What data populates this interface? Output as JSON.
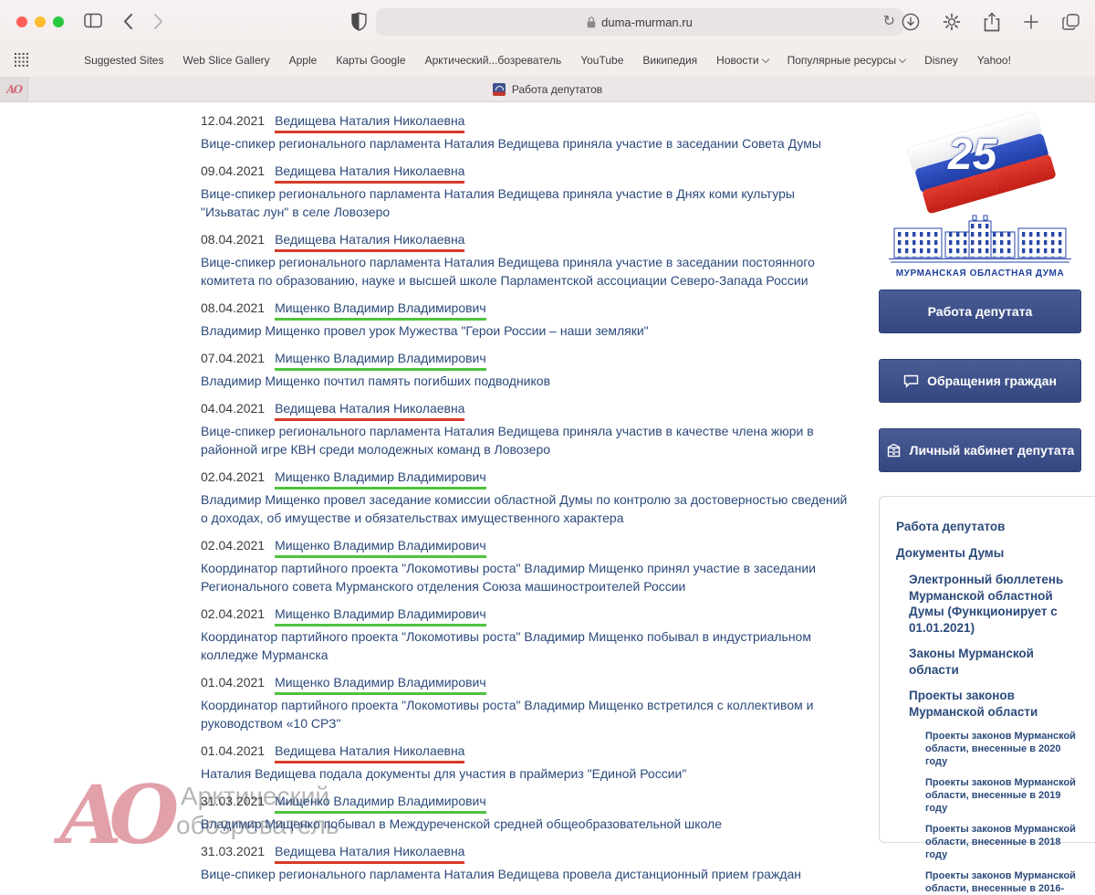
{
  "browser": {
    "traffic_lights": {
      "close": "#ff5f57",
      "minimize": "#febc2e",
      "zoom": "#28c840"
    },
    "address": {
      "url": "duma-murman.ru"
    },
    "bookmarks": [
      {
        "label": "Suggested Sites",
        "chevron": false
      },
      {
        "label": "Web Slice Gallery",
        "chevron": false
      },
      {
        "label": "Apple",
        "chevron": false
      },
      {
        "label": "Карты Google",
        "chevron": false
      },
      {
        "label": "Арктический...бозреватель",
        "chevron": false
      },
      {
        "label": "YouTube",
        "chevron": false
      },
      {
        "label": "Википедия",
        "chevron": false
      },
      {
        "label": "Новости",
        "chevron": true
      },
      {
        "label": "Популярные ресурсы",
        "chevron": true
      },
      {
        "label": "Disney",
        "chevron": false
      },
      {
        "label": "Yahoo!",
        "chevron": false
      }
    ],
    "tab": {
      "pinned_label": "АО",
      "title": "Работа депутатов"
    }
  },
  "news": [
    {
      "date": "12.04.2021",
      "author": "Ведищева Наталия Николаевна",
      "underline_color": "#d63b27",
      "text": "Вице-спикер регионального парламента Наталия Ведищева приняла участие в заседании Совета Думы"
    },
    {
      "date": "09.04.2021",
      "author": "Ведищева Наталия Николаевна",
      "underline_color": "#d63b27",
      "text": "Вице-спикер регионального парламента Наталия Ведищева приняла участие в Днях коми культуры \"Изьватас лун\" в селе Ловозеро"
    },
    {
      "date": "08.04.2021",
      "author": "Ведищева Наталия Николаевна",
      "underline_color": "#d63b27",
      "text": "Вице-спикер регионального парламента Наталия Ведищева приняла участие в заседании постоянного комитета по образованию, науке и высшей школе Парламентской ассоциации Северо-Запада России"
    },
    {
      "date": "08.04.2021",
      "author": "Мищенко Владимир Владимирович",
      "underline_color": "#4fc33f",
      "text": "Владимир Мищенко провел урок Мужества \"Герои России – наши земляки\""
    },
    {
      "date": "07.04.2021",
      "author": "Мищенко Владимир Владимирович",
      "underline_color": "#4fc33f",
      "text": "Владимир Мищенко почтил память погибших подводников"
    },
    {
      "date": "04.04.2021",
      "author": "Ведищева Наталия Николаевна",
      "underline_color": "#d63b27",
      "text": "Вице-спикер регионального парламента Наталия Ведищева приняла участив в качестве члена жюри в районной игре КВН среди молодежных команд в Ловозеро"
    },
    {
      "date": "02.04.2021",
      "author": "Мищенко Владимир Владимирович",
      "underline_color": "#4fc33f",
      "text": "Владимир Мищенко провел заседание комиссии областной Думы по контролю за достоверностью сведений о доходах, об имуществе и обязательствах имущественного характера"
    },
    {
      "date": "02.04.2021",
      "author": "Мищенко Владимир Владимирович",
      "underline_color": "#4fc33f",
      "text": "Координатор партийного проекта \"Локомотивы роста\" Владимир Мищенко принял участие в заседании Регионального совета Мурманского отделения Союза машиностроителей России"
    },
    {
      "date": "02.04.2021",
      "author": "Мищенко Владимир Владимирович",
      "underline_color": "#4fc33f",
      "text": "Координатор партийного проекта \"Локомотивы роста\" Владимир Мищенко побывал в индустриальном колледже Мурманска"
    },
    {
      "date": "01.04.2021",
      "author": "Мищенко Владимир Владимирович",
      "underline_color": "#4fc33f",
      "text": "Координатор партийного проекта \"Локомотивы роста\" Владимир Мищенко встретился с коллективом и руководством «10 СРЗ\""
    },
    {
      "date": "01.04.2021",
      "author": "Ведищева Наталия Николаевна",
      "underline_color": "#d63b27",
      "text": "Наталия Ведищева подала документы для участия в праймериз \"Единой России\""
    },
    {
      "date": "31.03.2021",
      "author": "Мищенко Владимир Владимирович",
      "underline_color": "#4fc33f",
      "text": "Владимир Мищенко побывал в Междуреченской средней общеобразовательной школе"
    },
    {
      "date": "31.03.2021",
      "author": "Ведищева Наталия Николаевна",
      "underline_color": "#d63b27",
      "text": "Вице-спикер регионального парламента Наталия Ведищева провела дистанционный прием граждан"
    }
  ],
  "sidebar": {
    "logo": {
      "number": "25",
      "number_label": "лет",
      "caption": "МУРМАНСКАЯ ОБЛАСТНАЯ ДУМА"
    },
    "buttons": [
      {
        "label": "Работа депутата",
        "icon": "none"
      },
      {
        "label": "Обращения граждан",
        "icon": "speech-bubble-icon"
      },
      {
        "label": "Личный кабинет депутата",
        "icon": "cabinet-icon"
      }
    ],
    "nav": [
      {
        "label": "Работа депутатов",
        "level": 1
      },
      {
        "label": "Документы Думы",
        "level": 1
      },
      {
        "label": "Электронный бюллетень Мурманской областной Думы (Функционирует с 01.01.2021)",
        "level": 2
      },
      {
        "label": "Законы Мурманской области",
        "level": 2
      },
      {
        "label": "Проекты законов Мурманской области",
        "level": 2
      },
      {
        "label": "Проекты законов Мурманской области, внесенные в 2020 году",
        "level": 3
      },
      {
        "label": "Проекты законов Мурманской области, внесенные в 2019 году",
        "level": 3
      },
      {
        "label": "Проекты законов Мурманской области, внесенные в 2018 году",
        "level": 3
      },
      {
        "label": "Проекты законов Мурманской области, внесенные в 2016-",
        "level": 3
      }
    ]
  },
  "watermark": {
    "monogram": "АО",
    "line1": "Арктический",
    "line2": "обозреватель"
  },
  "colors": {
    "link_blue": "#2b4a7b",
    "underline_red": "#d63b27",
    "underline_green": "#4fc33f",
    "button_navy": "#3d4f87"
  }
}
